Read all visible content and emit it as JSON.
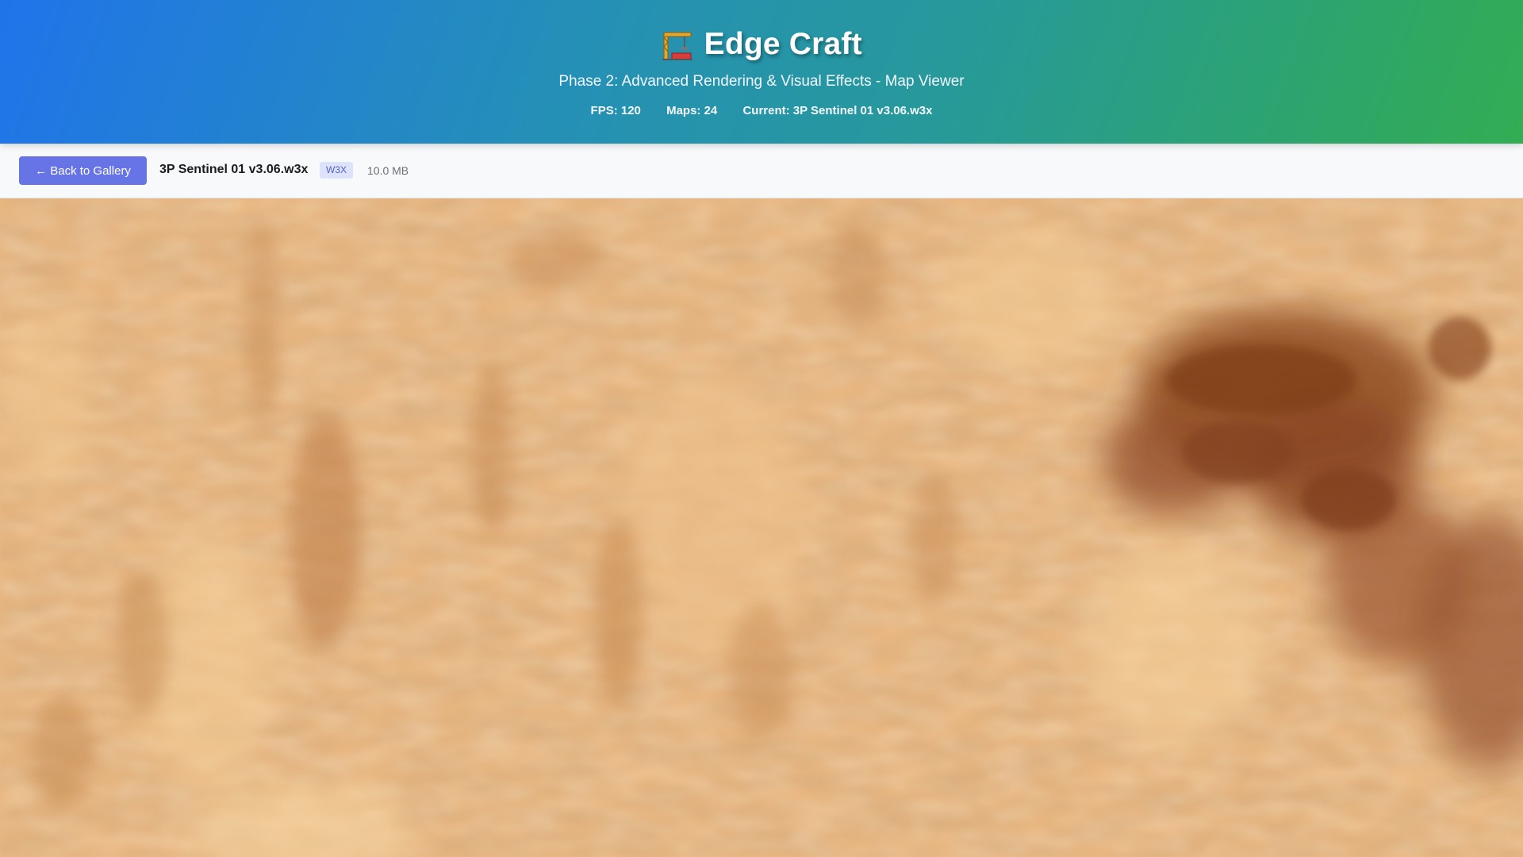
{
  "header": {
    "crane_icon": "construction-crane-icon",
    "title": "Edge Craft",
    "subtitle": "Phase 2: Advanced Rendering & Visual Effects - Map Viewer",
    "stats": {
      "fps": "FPS: 120",
      "maps": "Maps: 24",
      "current": "Current: 3P Sentinel 01 v3.06.w3x"
    }
  },
  "toolbar": {
    "back_label": "← Back to Gallery",
    "map_name": "3P Sentinel 01 v3.06.w3x",
    "format_badge": "W3X",
    "file_size": "10.0 MB"
  },
  "colors": {
    "header_gradient_start": "#2074ea",
    "header_gradient_end": "#33ad53",
    "back_button": "#6674e6",
    "badge_bg": "#dde3fb",
    "badge_text": "#5562c4",
    "terrain_base": "#e8b57f",
    "terrain_dark": "#8a4a25"
  }
}
